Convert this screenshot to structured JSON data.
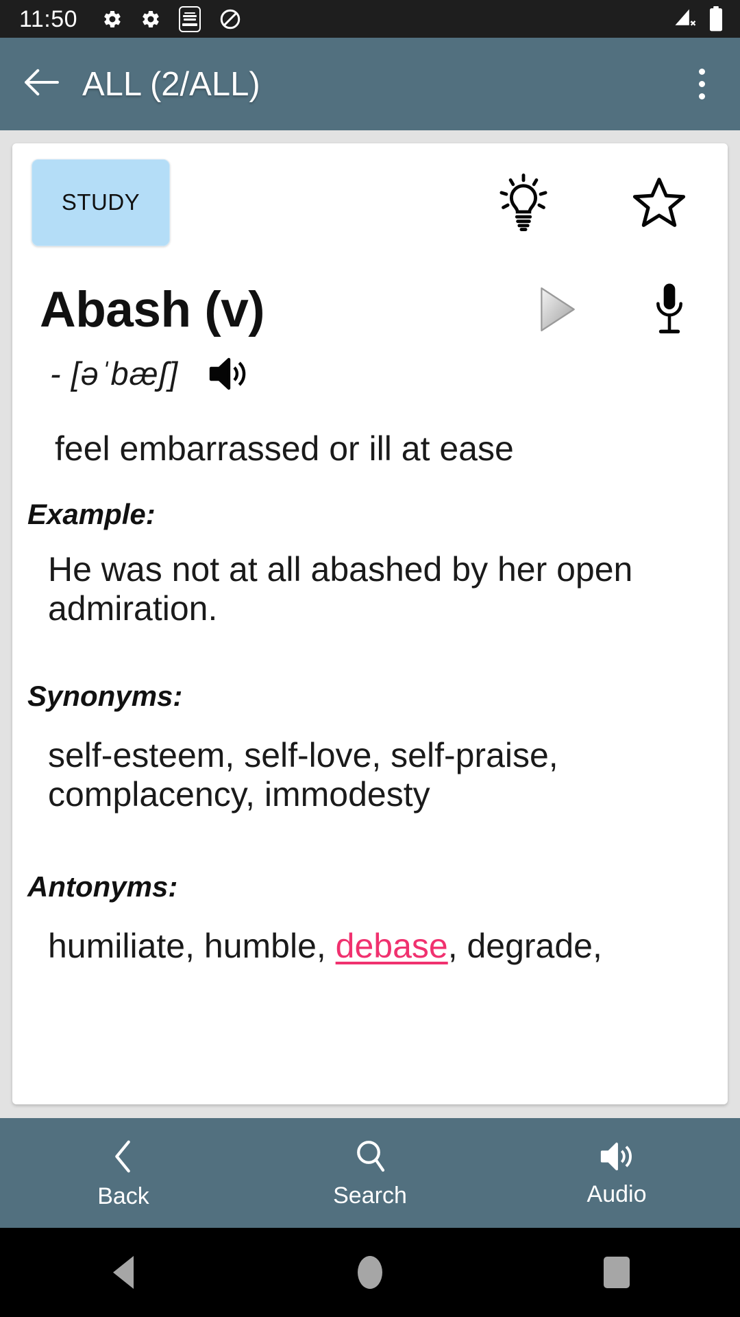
{
  "status_bar": {
    "time": "11:50",
    "icons": [
      "gear-icon",
      "gear-icon",
      "app-icon-english-phrasal-verbs",
      "do-not-disturb-icon",
      "signal-no-sim-icon",
      "battery-full-icon"
    ],
    "app_icon_lines": [
      "English",
      "Phrasal",
      "Verbs"
    ]
  },
  "app_bar": {
    "back_label": "back-arrow",
    "title": "ALL (2/ALL)",
    "overflow_label": "more-options",
    "background_color": "#52707F"
  },
  "card": {
    "study_button_label": "STUDY",
    "study_button_color": "#B4DDF7",
    "hint_icon": "lightbulb-icon",
    "favorite_icon": "star-outline-icon",
    "word": "Abash (v)",
    "play_icon": "play-icon",
    "mic_icon": "microphone-icon",
    "phonetic": "- [əˈbæʃ]",
    "speaker_icon": "speaker-icon",
    "definition": "feel embarrassed or ill at ease",
    "sections": {
      "example_label": "Example:",
      "example_text": "He was not at all abashed by her open admiration.",
      "synonyms_label": "Synonyms:",
      "synonyms_text": "self-esteem, self-love, self-praise, complacency, immodesty",
      "antonyms_label": "Antonyms:",
      "antonyms_before": "humiliate, humble, ",
      "antonyms_link": "debase",
      "antonyms_after": ", degrade,",
      "link_color": "#F0316F"
    }
  },
  "bottom_nav": {
    "items": [
      {
        "label": "Back",
        "icon": "chevron-left-icon"
      },
      {
        "label": "Search",
        "icon": "search-icon"
      },
      {
        "label": "Audio",
        "icon": "speaker-icon"
      }
    ],
    "background_color": "#52707F"
  },
  "system_nav": {
    "back": "system-back-icon",
    "home": "system-home-icon",
    "recents": "system-recents-icon"
  }
}
